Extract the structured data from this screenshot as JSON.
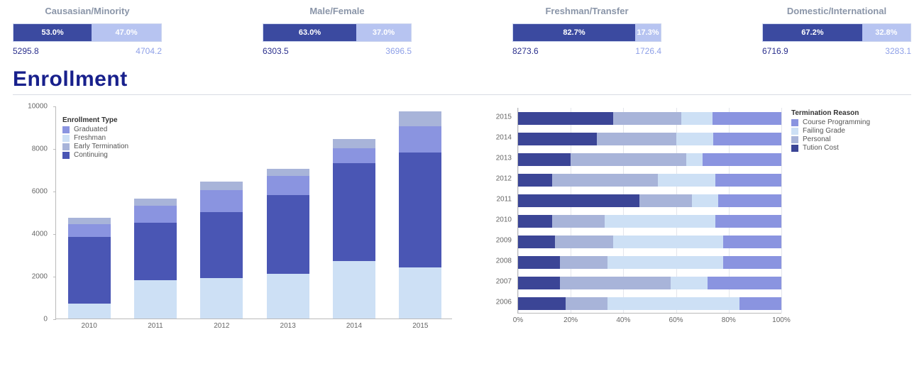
{
  "kpis": [
    {
      "title": "Causasian/Minority",
      "leftPct": "53.0%",
      "rightPct": "47.0%",
      "leftVal": "5295.8",
      "rightVal": "4704.2",
      "leftW": 53.0,
      "rightW": 47.0
    },
    {
      "title": "Male/Female",
      "leftPct": "63.0%",
      "rightPct": "37.0%",
      "leftVal": "6303.5",
      "rightVal": "3696.5",
      "leftW": 63.0,
      "rightW": 37.0
    },
    {
      "title": "Freshman/Transfer",
      "leftPct": "82.7%",
      "rightPct": "17.3%",
      "leftVal": "8273.6",
      "rightVal": "1726.4",
      "leftW": 82.7,
      "rightW": 17.3
    },
    {
      "title": "Domestic/International",
      "leftPct": "67.2%",
      "rightPct": "32.8%",
      "leftVal": "6716.9",
      "rightVal": "3283.1",
      "leftW": 67.2,
      "rightW": 32.8
    }
  ],
  "section_title": "Enrollment",
  "enroll_legend_title": "Enrollment Type",
  "enroll_legend": [
    "Graduated",
    "Freshman",
    "Early Termination",
    "Continuing"
  ],
  "term_legend_title": "Termination Reason",
  "term_legend": [
    "Course Programming",
    "Failing Grade",
    "Personal",
    "Tution Cost"
  ],
  "chart_data": [
    {
      "type": "bar",
      "stacked": true,
      "title": "",
      "xlabel": "",
      "ylabel": "",
      "ylim": [
        0,
        10000
      ],
      "yticks": [
        0,
        2000,
        4000,
        6000,
        8000,
        10000
      ],
      "categories": [
        "2010",
        "2011",
        "2012",
        "2013",
        "2014",
        "2015"
      ],
      "series": [
        {
          "name": "Continuing",
          "values": [
            3150,
            2700,
            3100,
            3700,
            4600,
            5400
          ]
        },
        {
          "name": "Early Termination",
          "values": [
            300,
            350,
            400,
            350,
            450,
            700
          ]
        },
        {
          "name": "Freshman",
          "values": [
            700,
            1800,
            1900,
            2100,
            2700,
            2400
          ]
        },
        {
          "name": "Graduated",
          "values": [
            600,
            800,
            1050,
            900,
            700,
            1250
          ]
        }
      ]
    },
    {
      "type": "bar",
      "orientation": "horizontal",
      "stacked": true,
      "percent": true,
      "title": "",
      "xlabel": "",
      "ylabel": "",
      "xlim": [
        0,
        100
      ],
      "xticks": [
        "0%",
        "20%",
        "40%",
        "60%",
        "80%",
        "100%"
      ],
      "categories": [
        "2015",
        "2014",
        "2013",
        "2012",
        "2011",
        "2010",
        "2009",
        "2008",
        "2007",
        "2006"
      ],
      "series": [
        {
          "name": "Tution Cost",
          "values": [
            36,
            30,
            20,
            13,
            46,
            13,
            14,
            16,
            16,
            18
          ]
        },
        {
          "name": "Personal",
          "values": [
            26,
            30,
            44,
            40,
            20,
            20,
            22,
            18,
            42,
            16
          ]
        },
        {
          "name": "Failing Grade",
          "values": [
            12,
            14,
            6,
            22,
            10,
            42,
            42,
            44,
            14,
            50
          ]
        },
        {
          "name": "Course Programming",
          "values": [
            26,
            26,
            30,
            25,
            24,
            25,
            22,
            22,
            28,
            16
          ]
        }
      ]
    }
  ]
}
